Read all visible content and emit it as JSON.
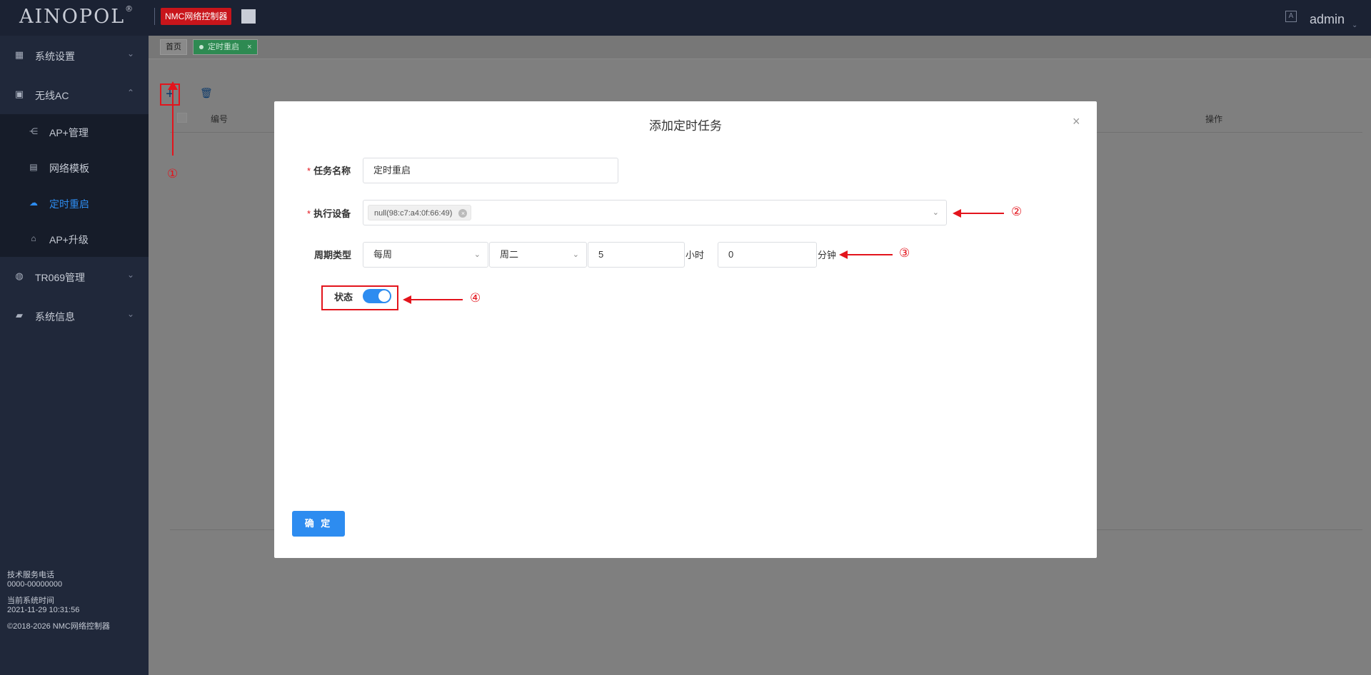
{
  "topbar": {
    "logo": "AINOPOL",
    "logo_reg": "®",
    "badge": "NMC网络控制器",
    "user": "admin"
  },
  "sidebar": {
    "items": [
      {
        "label": "系统设置",
        "icon": "grid-icon"
      },
      {
        "label": "无线AC",
        "icon": "chip-icon"
      },
      {
        "label": "TR069管理",
        "icon": "globe-icon"
      },
      {
        "label": "系统信息",
        "icon": "lock-icon"
      }
    ],
    "sub_items": [
      {
        "label": "AP+管理",
        "icon": "share-icon"
      },
      {
        "label": "网络模板",
        "icon": "clipboard-icon"
      },
      {
        "label": "定时重启",
        "icon": "cloud-icon"
      },
      {
        "label": "AP+升级",
        "icon": "home-icon"
      }
    ],
    "footer": {
      "support_label": "技术服务电话",
      "support_phone": "0000-00000000",
      "time_label": "当前系统时间",
      "time_value": "2021-11-29 10:31:56",
      "copyright": "©2018-2026 NMC网络控制器"
    }
  },
  "tabs": {
    "home": "首页",
    "current": "定时重启",
    "close": "×"
  },
  "table": {
    "col_number": "编号",
    "col_ops": "操作"
  },
  "modal": {
    "title": "添加定时任务",
    "close": "×",
    "task_name_label": "任务名称",
    "task_name_value": "定时重启",
    "device_label": "执行设备",
    "device_chip": "null(98:c7:a4:0f:66:49)",
    "period_label": "周期类型",
    "period_type": "每周",
    "weekday": "周二",
    "hour": "5",
    "hour_unit": "小时",
    "minute": "0",
    "minute_unit": "分钟",
    "status_label": "状态",
    "status_on": true,
    "confirm": "确 定"
  },
  "annotations": [
    "①",
    "②",
    "③",
    "④"
  ],
  "colors": {
    "topbar": "#1b2233",
    "sidebar": "#20283a",
    "accent": "#2d8cf0",
    "badge": "#c8151b",
    "annotation": "#e3141c"
  }
}
